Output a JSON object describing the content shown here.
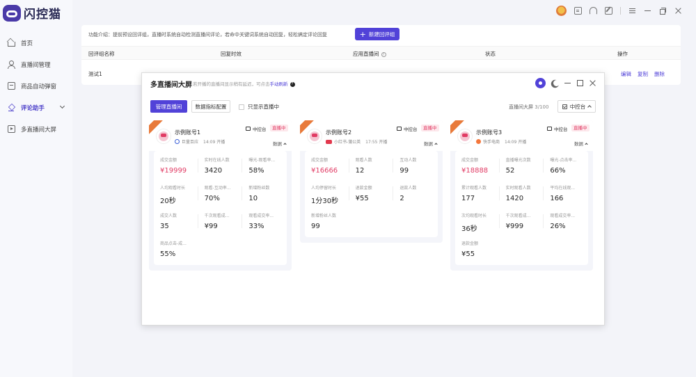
{
  "app": {
    "logo_text": "闪控猫"
  },
  "sidebar": {
    "items": [
      {
        "label": "首页",
        "icon": "home-icon"
      },
      {
        "label": "直播间管理",
        "icon": "user-icon"
      },
      {
        "label": "商品自动弹窗",
        "icon": "box-icon"
      },
      {
        "label": "评论助手",
        "icon": "layers-icon",
        "active": true
      },
      {
        "label": "多直播间大屏",
        "icon": "screen-icon"
      }
    ]
  },
  "main": {
    "intro": "功能介绍：提前预设回评组，直播时系统自动检测直播间评论，若命中关键词系统自动回复，轻松搞定评论回复",
    "new_button": "新建回评组",
    "table": {
      "headers": [
        "回评组名称",
        "回复时效",
        "应用直播间",
        "状态",
        "操作"
      ],
      "rows": [
        {
          "name": "测试1",
          "ops": [
            "编辑",
            "复制",
            "删除"
          ]
        }
      ]
    }
  },
  "modal": {
    "title": "多直播间大屏",
    "subtitle": "若开播的直播间显示稍有延迟，可点击",
    "subtitle_link": "手动刷新",
    "btn_manage": "管理直播间",
    "btn_metrics": "数据指标配置",
    "check_live_only": "只显示直播中",
    "screen_label": "直播间大屏",
    "screen_count": "3/100",
    "control_select": "中控台",
    "cards": [
      {
        "name": "示例账号1",
        "platform": "巨量百应",
        "time": "14:09 开播",
        "control": "中控台",
        "live": "直播中",
        "data_toggle": "数据",
        "metrics": [
          {
            "label": "成交金额",
            "value": "¥19999",
            "red": true
          },
          {
            "label": "实时在线人数",
            "value": "3420"
          },
          {
            "label": "曝光-观看率...",
            "value": "58%"
          },
          {
            "label": "人均观看时长",
            "value": "20秒"
          },
          {
            "label": "观看-互动率...",
            "value": "70%"
          },
          {
            "label": "新增粉丝数",
            "value": "10"
          },
          {
            "label": "成交人数",
            "value": "35"
          },
          {
            "label": "千次观看成...",
            "value": "¥99"
          },
          {
            "label": "观看成交率...",
            "value": "33%"
          },
          {
            "label": "商品点击-成...",
            "value": "55%"
          }
        ]
      },
      {
        "name": "示例账号2",
        "platform": "小红书-蒲公英",
        "time": "17:55 开播",
        "control": "中控台",
        "live": "直播中",
        "data_toggle": "数据",
        "metrics": [
          {
            "label": "成交金额",
            "value": "¥16666",
            "red": true
          },
          {
            "label": "观看人数",
            "value": "12"
          },
          {
            "label": "互动人数",
            "value": "99"
          },
          {
            "label": "人均停留时长",
            "value": "1分30秒"
          },
          {
            "label": "退款金额",
            "value": "¥55"
          },
          {
            "label": "退款人数",
            "value": "2"
          },
          {
            "label": "新增粉丝人数",
            "value": "99"
          }
        ]
      },
      {
        "name": "示例账号3",
        "platform": "快手电商",
        "time": "14:09 开播",
        "control": "中控台",
        "live": "直播中",
        "data_toggle": "数据",
        "metrics": [
          {
            "label": "成交金额",
            "value": "¥18888",
            "red": true
          },
          {
            "label": "直播曝光次数",
            "value": "52"
          },
          {
            "label": "曝光-点击率...",
            "value": "66%"
          },
          {
            "label": "累计观看人数",
            "value": "177"
          },
          {
            "label": "实时观看人数",
            "value": "1420"
          },
          {
            "label": "平均在线观...",
            "value": "166"
          },
          {
            "label": "次均观看时长",
            "value": "36秒"
          },
          {
            "label": "千次观看成...",
            "value": "¥999"
          },
          {
            "label": "观看成交率...",
            "value": "26%"
          },
          {
            "label": "退款金额",
            "value": "¥55"
          }
        ]
      }
    ]
  },
  "colors": {
    "accent": "#5142d8",
    "live_red": "#e13b64",
    "ribbon": "#e87a3a"
  }
}
